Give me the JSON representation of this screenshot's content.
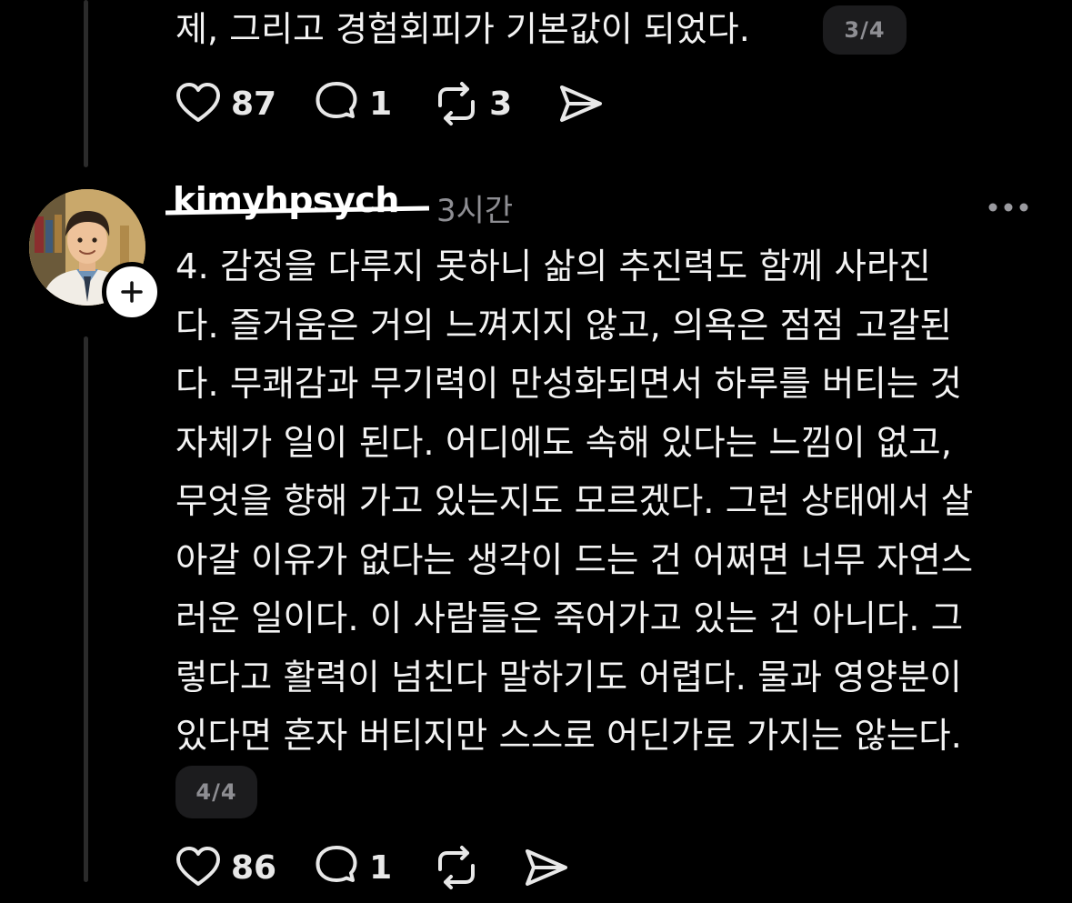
{
  "previous_post": {
    "text_tail": "제, 그리고 경험회피가 기본값이 되었다.",
    "page_indicator": "3/4",
    "likes": "87",
    "replies": "1",
    "reposts": "3"
  },
  "post": {
    "username": "kimyhpsych",
    "time_ago": "3시간",
    "lines": [
      "4. 감정을 다루지 못하니 삶의 추진력도 함께 사라진",
      "다. 즐거움은 거의 느껴지지 않고, 의욕은 점점 고갈된",
      "다. 무쾌감과 무기력이 만성화되면서 하루를 버티는 것",
      "자체가 일이 된다. 어디에도 속해 있다는 느낌이 없고,",
      "무엇을 향해 가고 있는지도 모르겠다. 그런 상태에서 살",
      "아갈 이유가 없다는 생각이 드는 건 어쩌면 너무 자연스",
      "러운 일이다.  이 사람들은 죽어가고 있는 건 아니다. 그",
      "렇다고 활력이 넘친다 말하기도 어렵다. 물과 영양분이",
      "있다면 혼자 버티지만 스스로 어딘가로 가지는 않는다."
    ],
    "page_indicator": "4/4",
    "likes": "86",
    "replies": "1"
  },
  "icons": {
    "like": "heart-icon",
    "reply": "speech-bubble-icon",
    "repost": "repost-icon",
    "share": "paper-plane-icon",
    "more": "more-dots-icon",
    "follow": "plus-icon"
  }
}
